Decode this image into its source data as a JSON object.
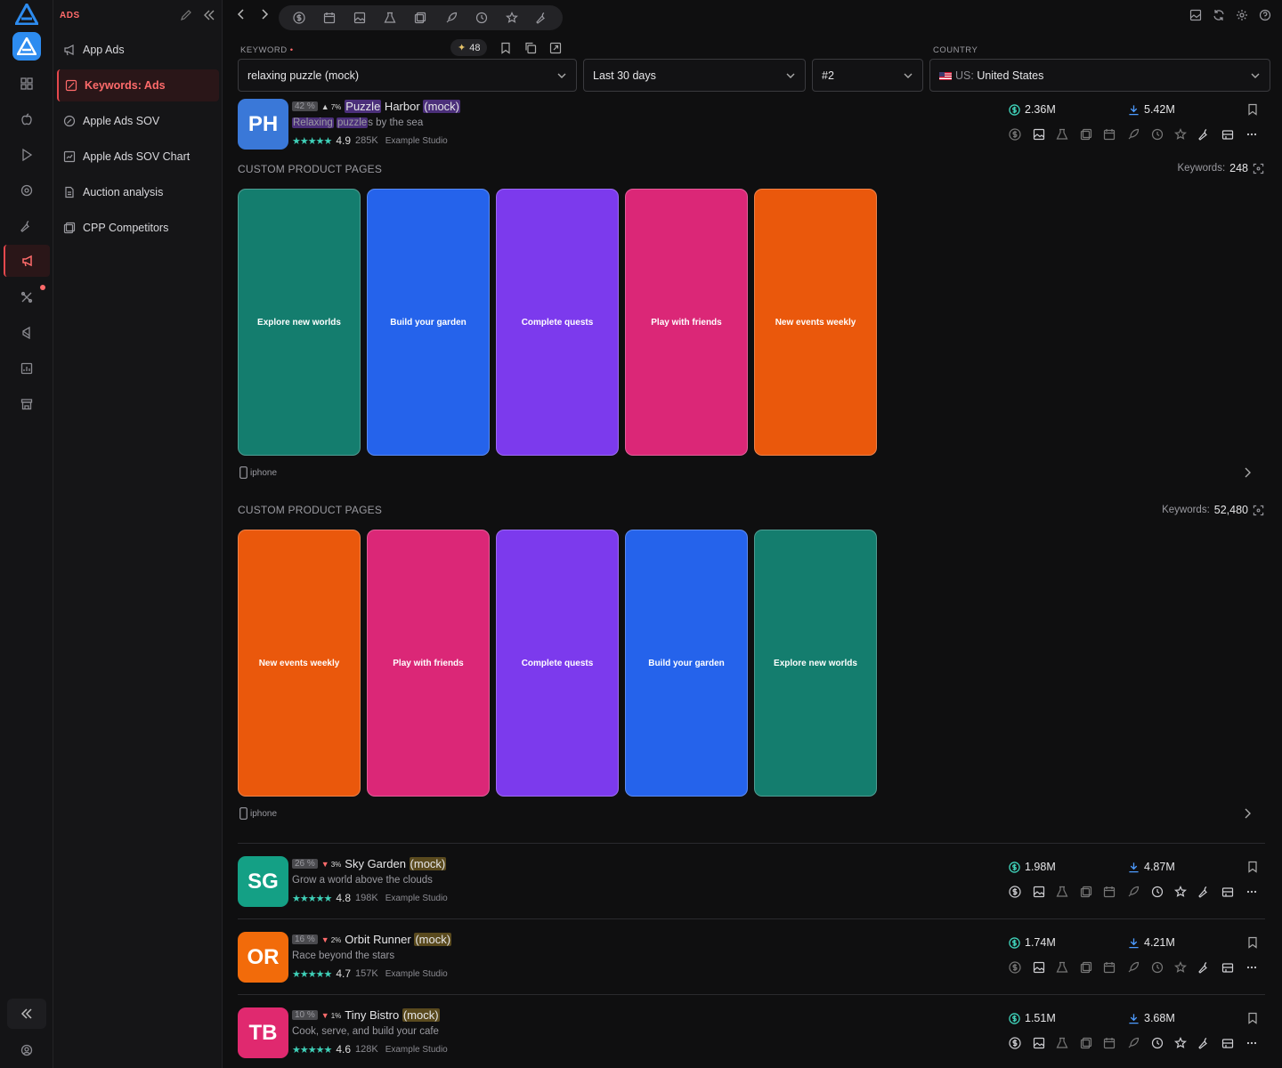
{
  "sidebar": {
    "header": "ADS",
    "items": [
      {
        "label": "App Ads",
        "icon": "megaphone-icon"
      },
      {
        "label": "Keywords: Ads",
        "icon": "keyword-icon",
        "active": true
      },
      {
        "label": "Apple Ads SOV",
        "icon": "gauge-icon"
      },
      {
        "label": "Apple Ads SOV Chart",
        "icon": "chart-icon"
      },
      {
        "label": "Auction analysis",
        "icon": "document-icon"
      },
      {
        "label": "CPP Competitors",
        "icon": "layers-icon"
      }
    ]
  },
  "filters": {
    "keyword_label": "KEYWORD",
    "keyword_required": "•",
    "keyword_value": "relaxing puzzle (mock)",
    "keyword_count": "48",
    "period_value": "Last 30 days",
    "rank_value": "#2",
    "country_label": "COUNTRY",
    "country_prefix": "US:",
    "country_value": "United States"
  },
  "apps": [
    {
      "initials": "PH",
      "color": "#3a78d8",
      "pct": "42 %",
      "delta": "7%",
      "delta_dir": "up",
      "name_pre": "Puzzle",
      "name_mid": " Harbor ",
      "name_tag": "(mock)",
      "sub_a": "Relaxing",
      "sub_b": "puzzle",
      "sub_c": "s by the sea",
      "stars": "★★★★★",
      "rating": "4.9",
      "reviews": "285K",
      "studio": "Example Studio",
      "revenue": "2.36M",
      "downloads": "5.42M"
    },
    {
      "initials": "SG",
      "color": "#14a085",
      "pct": "26 %",
      "delta": "3%",
      "delta_dir": "down",
      "name": "Sky Garden ",
      "name_tag": "(mock)",
      "sub": "Grow a world above the clouds",
      "stars": "★★★★★",
      "rating": "4.8",
      "reviews": "198K",
      "studio": "Example Studio",
      "revenue": "1.98M",
      "downloads": "4.87M"
    },
    {
      "initials": "OR",
      "color": "#f26b0a",
      "pct": "16 %",
      "delta": "2%",
      "delta_dir": "down",
      "name": "Orbit Runner ",
      "name_tag": "(mock)",
      "sub": "Race beyond the stars",
      "stars": "★★★★★",
      "rating": "4.7",
      "reviews": "157K",
      "studio": "Example Studio",
      "revenue": "1.74M",
      "downloads": "4.21M"
    },
    {
      "initials": "TB",
      "color": "#e0296f",
      "pct": "10 %",
      "delta": "1%",
      "delta_dir": "down",
      "name": "Tiny Bistro ",
      "name_tag": "(mock)",
      "sub": "Cook, serve, and build your cafe",
      "stars": "★★★★★",
      "rating": "4.6",
      "reviews": "128K",
      "studio": "Example Studio",
      "revenue": "1.51M",
      "downloads": "3.68M"
    }
  ],
  "cpp": [
    {
      "title": "CUSTOM PRODUCT PAGES",
      "keywords_label": "Keywords:",
      "keywords": "248",
      "device": "iphone",
      "cards": [
        {
          "text": "Explore new worlds",
          "color": "#147d6e"
        },
        {
          "text": "Build your garden",
          "color": "#2563eb"
        },
        {
          "text": "Complete quests",
          "color": "#7c3aed"
        },
        {
          "text": "Play with friends",
          "color": "#db2777"
        },
        {
          "text": "New events weekly",
          "color": "#ea580c"
        }
      ]
    },
    {
      "title": "CUSTOM PRODUCT PAGES",
      "keywords_label": "Keywords:",
      "keywords": "52,480",
      "device": "iphone",
      "cards": [
        {
          "text": "New events weekly",
          "color": "#ea580c"
        },
        {
          "text": "Play with friends",
          "color": "#db2777"
        },
        {
          "text": "Complete quests",
          "color": "#7c3aed"
        },
        {
          "text": "Build your garden",
          "color": "#2563eb"
        },
        {
          "text": "Explore new worlds",
          "color": "#147d6e"
        }
      ]
    }
  ],
  "colors": {
    "accent": "#e5484d",
    "teal": "#3fd0b8",
    "brand": "#2d8cf0"
  }
}
